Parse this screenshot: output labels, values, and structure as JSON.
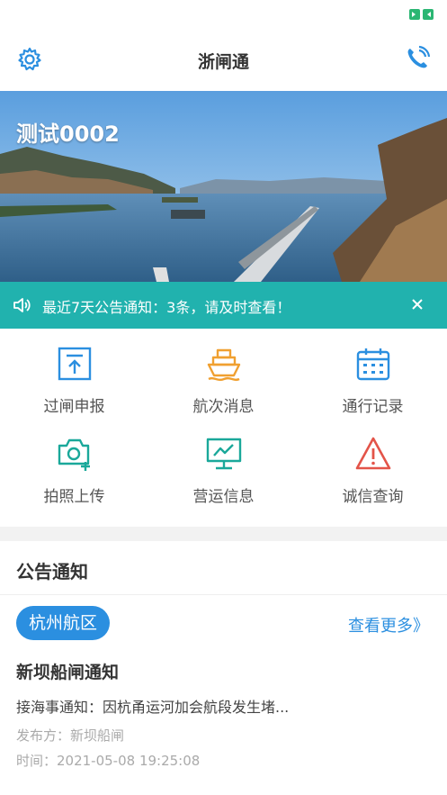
{
  "app": {
    "title": "浙闸通"
  },
  "colors": {
    "accent": "#21b2ae",
    "link": "#2b8fe0",
    "warn": "#e35449",
    "orange": "#f0a030",
    "teal": "#1aa89a"
  },
  "icons": {
    "left": "gear-icon",
    "right": "phone-icon",
    "status": "battery-icon"
  },
  "banner": {
    "title": "测试0002"
  },
  "notice": {
    "text": "最近7天公告通知：3条，请及时查看！",
    "icon": "speaker-icon",
    "close_icon": "close-icon"
  },
  "grid": [
    {
      "label": "过闸申报",
      "icon": "upload-document-icon"
    },
    {
      "label": "航次消息",
      "icon": "ship-icon"
    },
    {
      "label": "通行记录",
      "icon": "calendar-icon"
    },
    {
      "label": "拍照上传",
      "icon": "camera-add-icon"
    },
    {
      "label": "营运信息",
      "icon": "monitor-chart-icon"
    },
    {
      "label": "诚信查询",
      "icon": "warning-triangle-icon"
    }
  ],
  "announcements": {
    "title": "公告通知",
    "region": "杭州航区",
    "more_label": "查看更多》",
    "item": {
      "title": "新坝船闸通知",
      "summary": "接海事通知：因杭甬运河加会航段发生堵...",
      "publisher": "发布方：新坝船闸",
      "time": "时间：2021-05-08 19:25:08"
    }
  }
}
